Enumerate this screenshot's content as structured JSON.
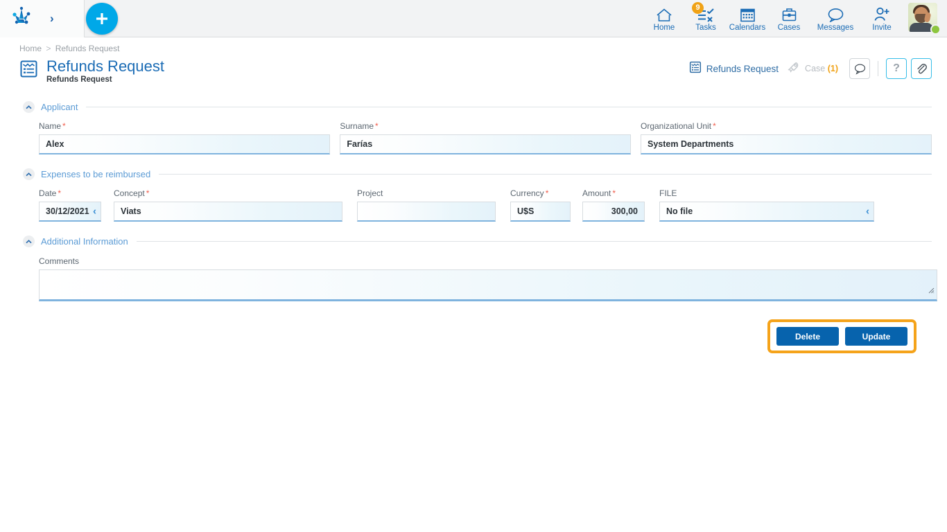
{
  "topbar": {
    "logo_icon": "bizagi-node-logo",
    "expand_icon": "chevron-right-icon",
    "create_button": {
      "icon": "plus-icon",
      "label": ""
    },
    "nav_items": [
      {
        "label": "Home",
        "icon": "home-icon",
        "badge": ""
      },
      {
        "label": "Tasks",
        "icon": "tasks-checklist-icon",
        "badge": "9"
      },
      {
        "label": "Calendars",
        "icon": "calendar-icon",
        "badge": ""
      },
      {
        "label": "Cases",
        "icon": "briefcase-icon",
        "badge": ""
      },
      {
        "label": "Messages",
        "icon": "message-bubble-icon",
        "badge": ""
      },
      {
        "label": "Invite",
        "icon": "user-add-icon",
        "badge": ""
      }
    ],
    "avatar": {
      "icon": "user-avatar",
      "status": "online"
    }
  },
  "breadcrumb": {
    "home": "Home",
    "separator": ">",
    "current": "Refunds Request"
  },
  "page_header": {
    "icon": "form-document-icon",
    "title": "Refunds Request",
    "subtitle": "Refunds Request",
    "tag": {
      "icon": "form-document-icon",
      "label": "Refunds Request"
    },
    "case": {
      "icon": "rocket-icon",
      "label": "Case",
      "count": "(1)"
    },
    "actions": [
      {
        "name": "comments-button",
        "icon": "message-bubble-icon"
      },
      {
        "name": "help-button",
        "icon": "question-mark-icon"
      },
      {
        "name": "attachments-button",
        "icon": "paperclip-icon"
      }
    ]
  },
  "sections": {
    "applicant": {
      "title": "Applicant",
      "collapse_icon": "chevron-up-icon",
      "fields": {
        "name": {
          "label": "Name",
          "required": "*",
          "value": "Alex",
          "placeholder": ""
        },
        "surname": {
          "label": "Surname",
          "required": "*",
          "value": "Farías",
          "placeholder": ""
        },
        "org_unit": {
          "label": "Organizational Unit",
          "required": "*",
          "value": "System Departments",
          "placeholder": ""
        }
      }
    },
    "expenses": {
      "title": "Expenses to be reimbursed",
      "collapse_icon": "chevron-up-icon",
      "fields": {
        "date": {
          "label": "Date",
          "required": "*",
          "value": "30/12/2021",
          "placeholder": "",
          "icon": "calendar-chevron-icon"
        },
        "concept": {
          "label": "Concept",
          "required": "*",
          "value": "Viats",
          "placeholder": ""
        },
        "project": {
          "label": "Project",
          "required": "",
          "value": "",
          "placeholder": ""
        },
        "currency": {
          "label": "Currency",
          "required": "*",
          "value": "U$S",
          "placeholder": ""
        },
        "amount": {
          "label": "Amount",
          "required": "*",
          "value": "300,00",
          "placeholder": ""
        },
        "file": {
          "label": "FILE",
          "required": "",
          "value": "No file",
          "placeholder": "",
          "icon": "file-chevron-icon"
        }
      }
    },
    "additional": {
      "title": "Additional Information",
      "collapse_icon": "chevron-up-icon",
      "fields": {
        "comments": {
          "label": "Comments",
          "required": "",
          "value": "",
          "placeholder": ""
        }
      }
    }
  },
  "footer_actions": {
    "delete_label": "Delete",
    "update_label": "Update",
    "highlight_color": "#f5a31a",
    "button_color": "#0763ad"
  },
  "colors": {
    "accent_blue": "#1b6cb5",
    "cyan": "#00a8e8",
    "orange": "#f0a216",
    "required_red": "#f05c4b",
    "section_title": "#5b9bd5"
  }
}
